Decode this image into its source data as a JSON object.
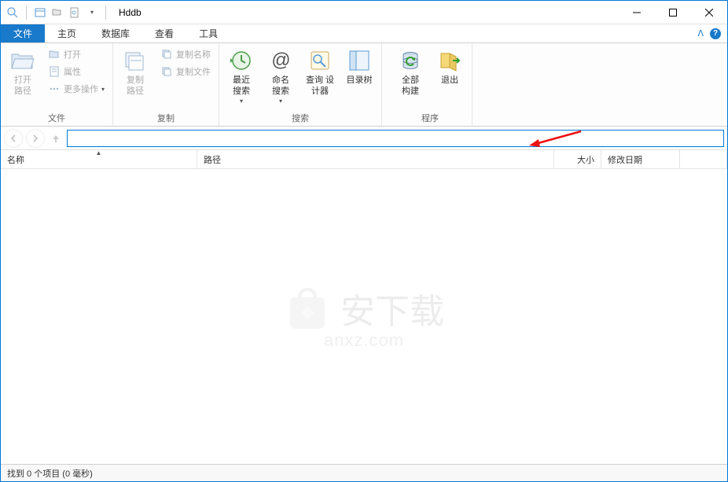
{
  "app": {
    "title": "Hddb"
  },
  "tabs": {
    "file": "文件",
    "home": "主页",
    "database": "数据库",
    "view": "查看",
    "tools": "工具"
  },
  "ribbon": {
    "groups": {
      "file": {
        "label": "文件",
        "open_path": "打开\n路径",
        "open": "打开",
        "properties": "属性",
        "more_ops": "更多操作"
      },
      "copy": {
        "label": "复制",
        "copy_path": "复制\n路径",
        "copy_name": "复制名称",
        "copy_file": "复制文件"
      },
      "search": {
        "label": "搜索",
        "recent_search": "最近\n搜索",
        "name_search": "命名\n搜索",
        "query_designer": "查询 设\n计器",
        "dir_tree": "目录树"
      },
      "program": {
        "label": "程序",
        "build_all": "全部\n构建",
        "exit": "退出"
      }
    }
  },
  "columns": {
    "name": "名称",
    "path": "路径",
    "size": "大小",
    "date": "修改日期"
  },
  "search": {
    "value": ""
  },
  "statusbar": {
    "text": "找到 0 个项目 (0 毫秒)"
  },
  "watermark": {
    "text": "安下载",
    "url": "anxz.com"
  }
}
